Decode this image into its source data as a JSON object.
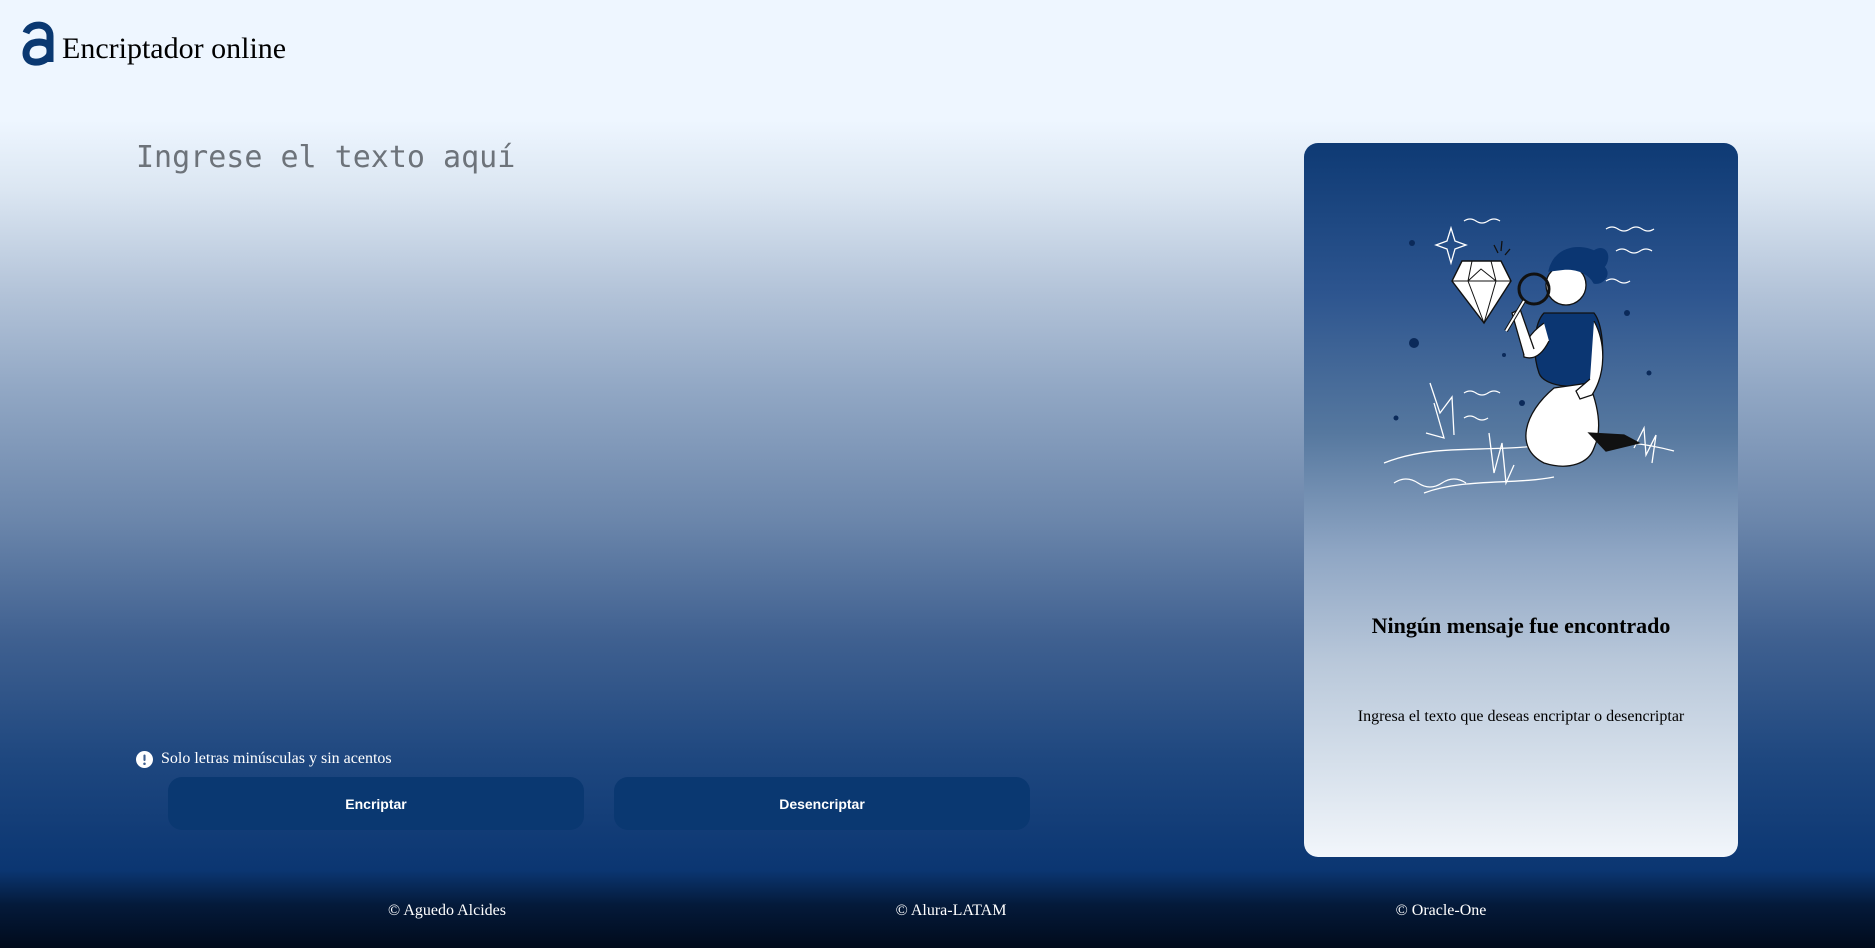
{
  "header": {
    "logo_icon": "alura-a-logo-icon",
    "title": "Encriptador online"
  },
  "input": {
    "placeholder": "Ingrese el texto aquí",
    "value": ""
  },
  "hint": {
    "icon": "exclamation-circle-icon",
    "text": "Solo letras minúsculas y sin acentos"
  },
  "buttons": {
    "encrypt_label": "Encriptar",
    "decrypt_label": "Desencriptar"
  },
  "output_panel": {
    "illustration": "person-with-magnifier-and-diamond-illustration",
    "title": "Ningún mensaje fue encontrado",
    "subtitle": "Ingresa el texto que deseas encriptar o desencriptar"
  },
  "footer": {
    "credits": [
      "© Aguedo Alcides",
      "© Alura-LATAM",
      "© Oracle-One"
    ]
  },
  "colors": {
    "brand": "#0a3871",
    "button_text": "#ffffff",
    "placeholder": "#6d737a",
    "page_top": "#eef6ff",
    "page_bottom": "#010b1c"
  }
}
